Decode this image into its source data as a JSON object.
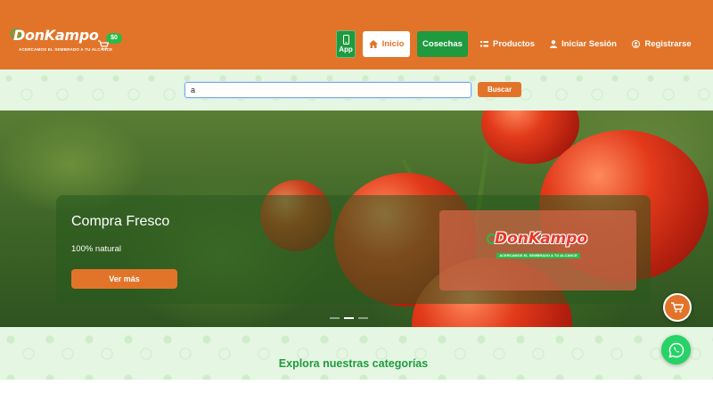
{
  "header": {
    "logo_text": "DonKampo",
    "logo_tagline": "ACERCAMOS EL SEMBRADO A TU ALCANCE",
    "cart_badge": "$0",
    "nav": {
      "app_label": "App",
      "inicio_label": "Inicio",
      "cosechas_label": "Cosechas",
      "productos_label": "Productos",
      "login_label": "Iniciar Sesión",
      "register_label": "Registrarse"
    }
  },
  "search": {
    "value": "a",
    "button_label": "Buscar"
  },
  "hero": {
    "title": "Compra Fresco",
    "subtitle": "100% natural",
    "cta_label": "Ver más",
    "logo_text": "DonKampo",
    "logo_tagline": "ACERCAMOS EL SEMBRADO A TU ALCANCE",
    "slides_count": 3,
    "active_slide": 2
  },
  "categories": {
    "title": "Explora nuestras categorías"
  },
  "colors": {
    "brand_orange": "#e2742a",
    "brand_green": "#1f9a3f",
    "whatsapp_green": "#25d366"
  },
  "icons": {
    "cart": "cart-icon",
    "phone": "smartphone-icon",
    "home": "home-icon",
    "grid": "grid-icon",
    "user": "user-icon",
    "user_circle": "user-circle-icon",
    "whatsapp": "whatsapp-icon"
  }
}
